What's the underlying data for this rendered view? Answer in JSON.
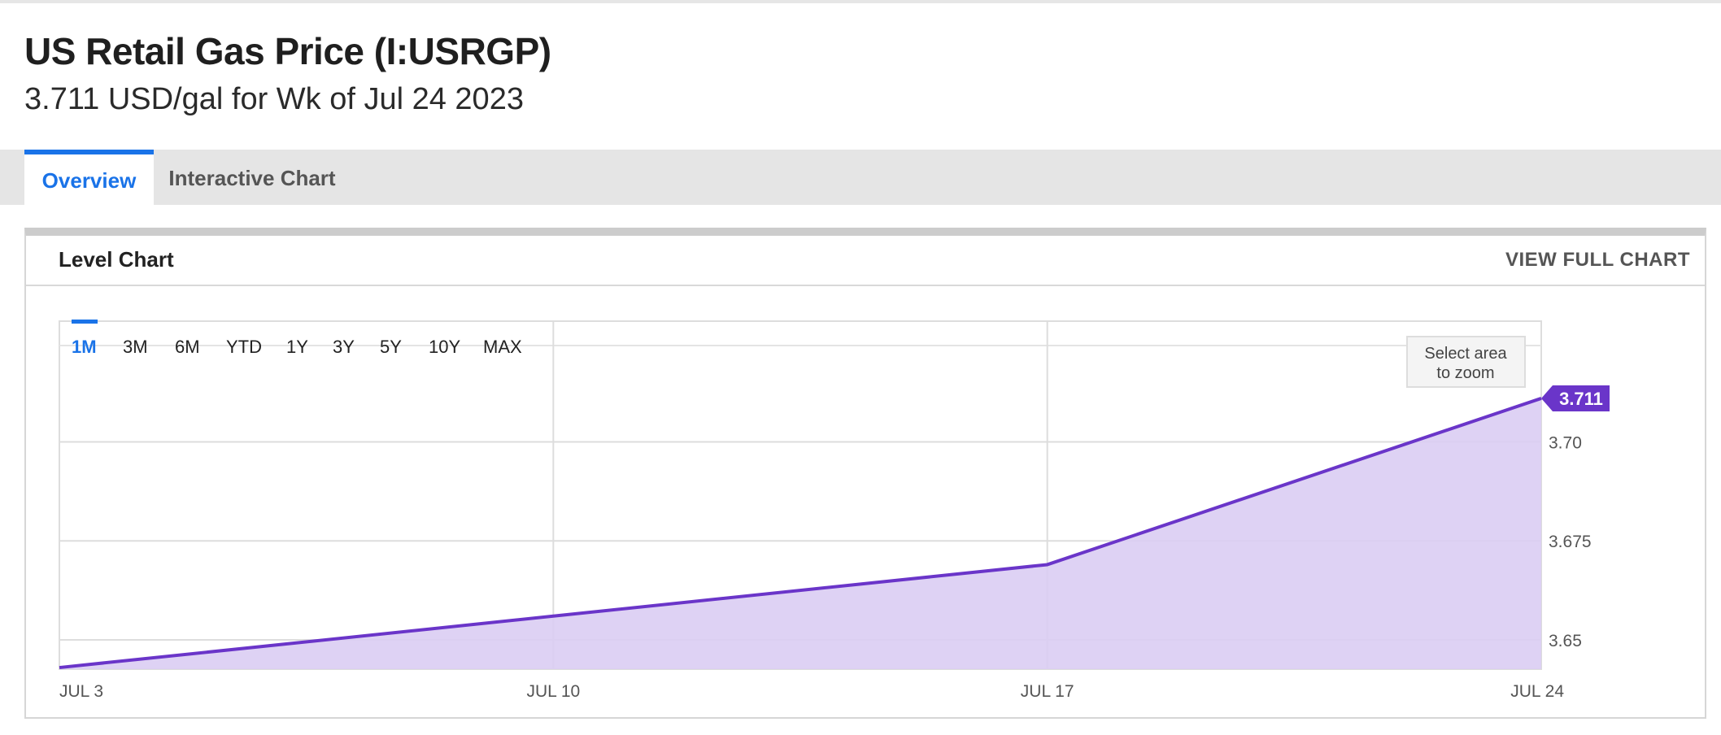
{
  "header": {
    "title": "US Retail Gas Price (I:USRGP)",
    "subtitle": "3.711 USD/gal for Wk of Jul 24 2023"
  },
  "tabs": [
    {
      "label": "Overview",
      "active": true
    },
    {
      "label": "Interactive Chart",
      "active": false
    }
  ],
  "card": {
    "title": "Level Chart",
    "full_chart_label": "VIEW FULL CHART"
  },
  "range_buttons": [
    {
      "label": "1M",
      "active": true
    },
    {
      "label": "3M",
      "active": false
    },
    {
      "label": "6M",
      "active": false
    },
    {
      "label": "YTD",
      "active": false
    },
    {
      "label": "1Y",
      "active": false
    },
    {
      "label": "3Y",
      "active": false
    },
    {
      "label": "5Y",
      "active": false
    },
    {
      "label": "10Y",
      "active": false
    },
    {
      "label": "MAX",
      "active": false
    }
  ],
  "zoom_hint": [
    "Select area",
    "to zoom"
  ],
  "colors": {
    "accent": "#1a73e8",
    "line": "#6a35c9",
    "fill": "#dacdf3",
    "badge": "#6a35c9"
  },
  "chart_data": {
    "type": "area",
    "x": [
      "JUL 3",
      "JUL 10",
      "JUL 17",
      "JUL 24"
    ],
    "series": [
      {
        "values": [
          3.643,
          3.656,
          3.669,
          3.711
        ]
      }
    ],
    "y_ticks": [
      {
        "value": 3.65,
        "label": "3.65"
      },
      {
        "value": 3.675,
        "label": "3.675"
      },
      {
        "value": 3.7,
        "label": "3.70"
      }
    ],
    "ylim": [
      3.6426,
      3.7305
    ],
    "last_value_label": "3.711",
    "grid": true
  }
}
